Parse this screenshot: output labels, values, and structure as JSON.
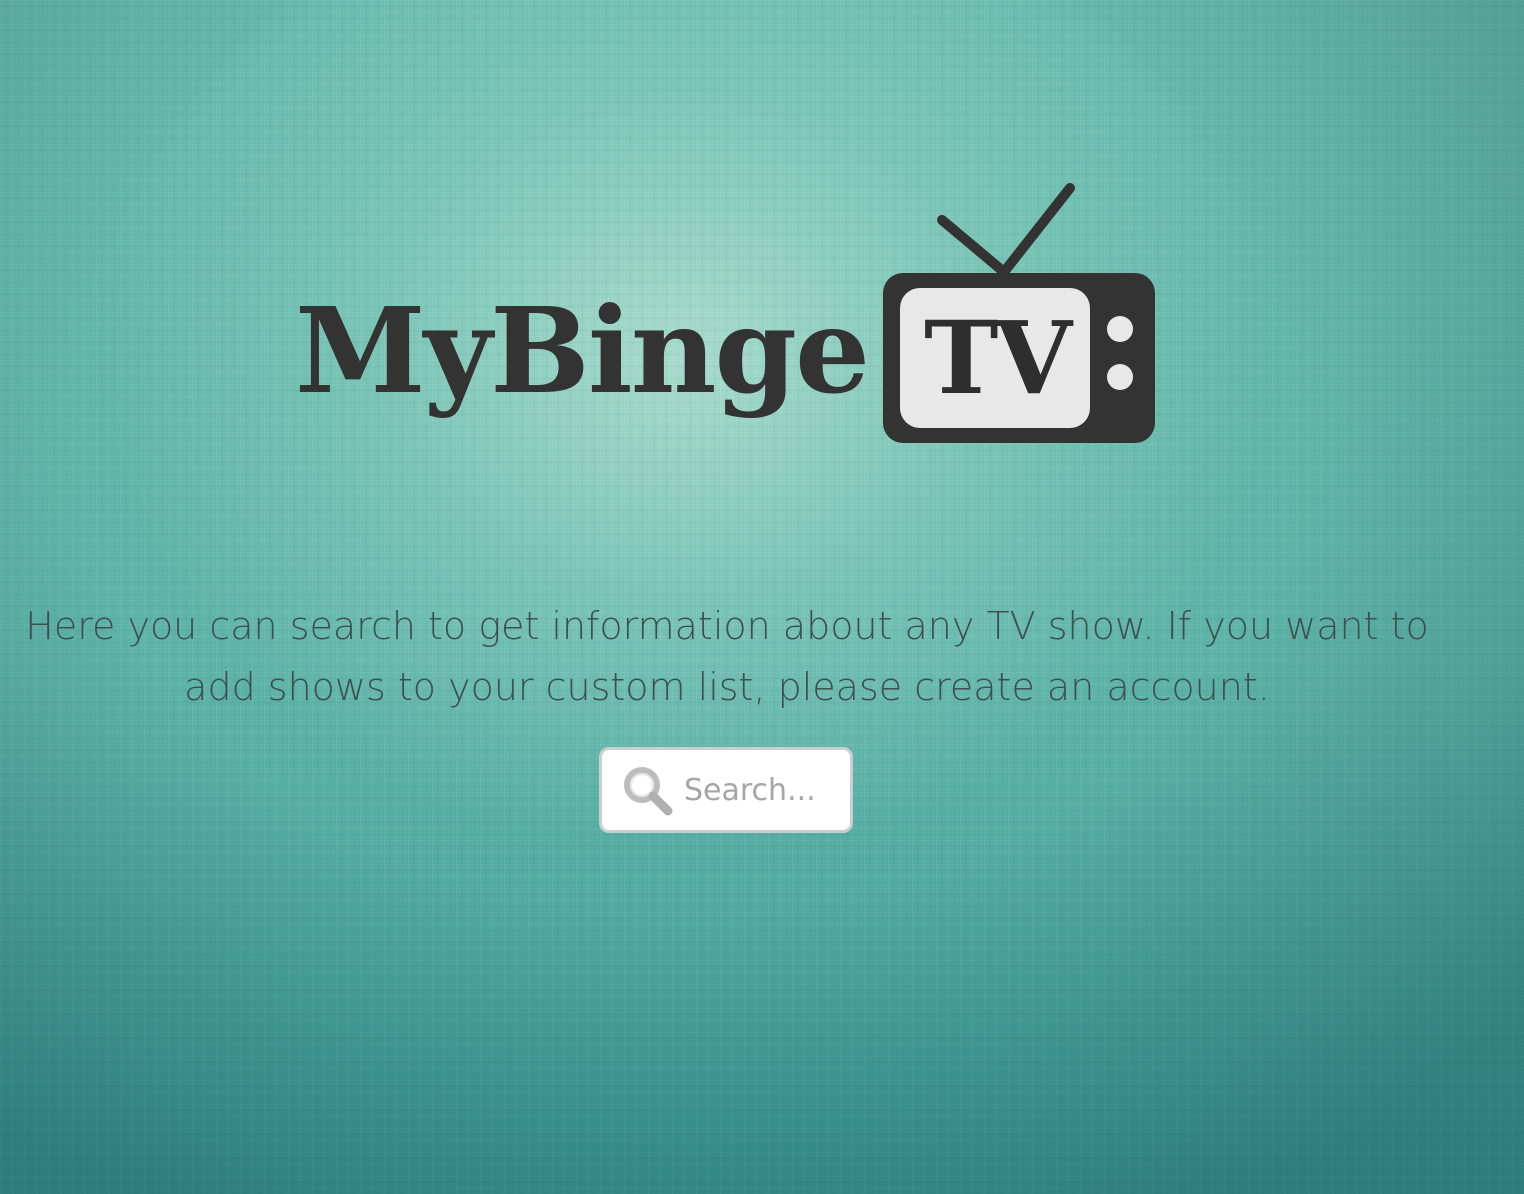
{
  "logo": {
    "word": "MyBinge",
    "tv_text": "TV",
    "icon": "tv-icon",
    "color": "#333333",
    "screen_color": "#e8e8e8"
  },
  "intro": {
    "line1": "Here you can search to get information about any TV show. If you want to",
    "line2": "add shows to your custom list, please create an account."
  },
  "search": {
    "placeholder": "Search...",
    "value": "",
    "icon": "search-icon"
  },
  "colors": {
    "background_top": "#9fd8c8",
    "background_bottom": "#3f9c98",
    "text": "#3f4f4e"
  }
}
